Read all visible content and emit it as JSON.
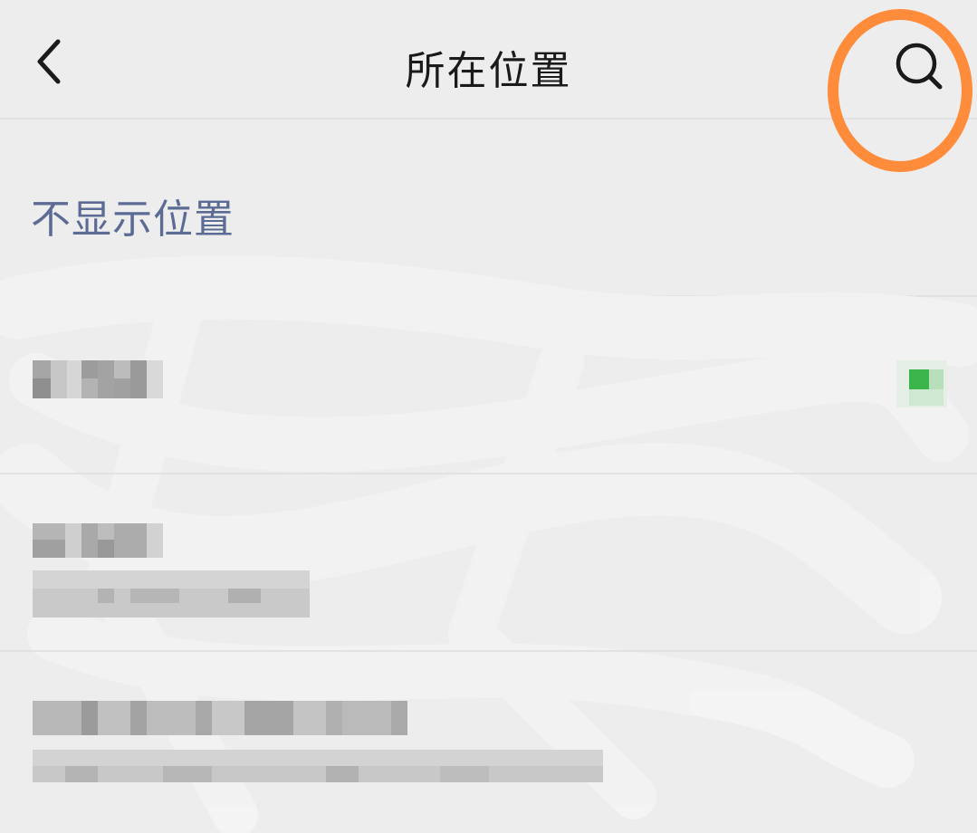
{
  "header": {
    "title": "所在位置",
    "back_icon": "chevron-left-icon",
    "search_icon": "search-icon",
    "highlight_color": "#ff8c3a"
  },
  "options": {
    "hide_location_label": "不显示位置"
  },
  "location_list": {
    "selected_index": 0,
    "check_color": "#39b54a",
    "items": [
      {
        "name": "",
        "address": ""
      },
      {
        "name": "",
        "address": ""
      },
      {
        "name": "",
        "address": ""
      }
    ]
  }
}
